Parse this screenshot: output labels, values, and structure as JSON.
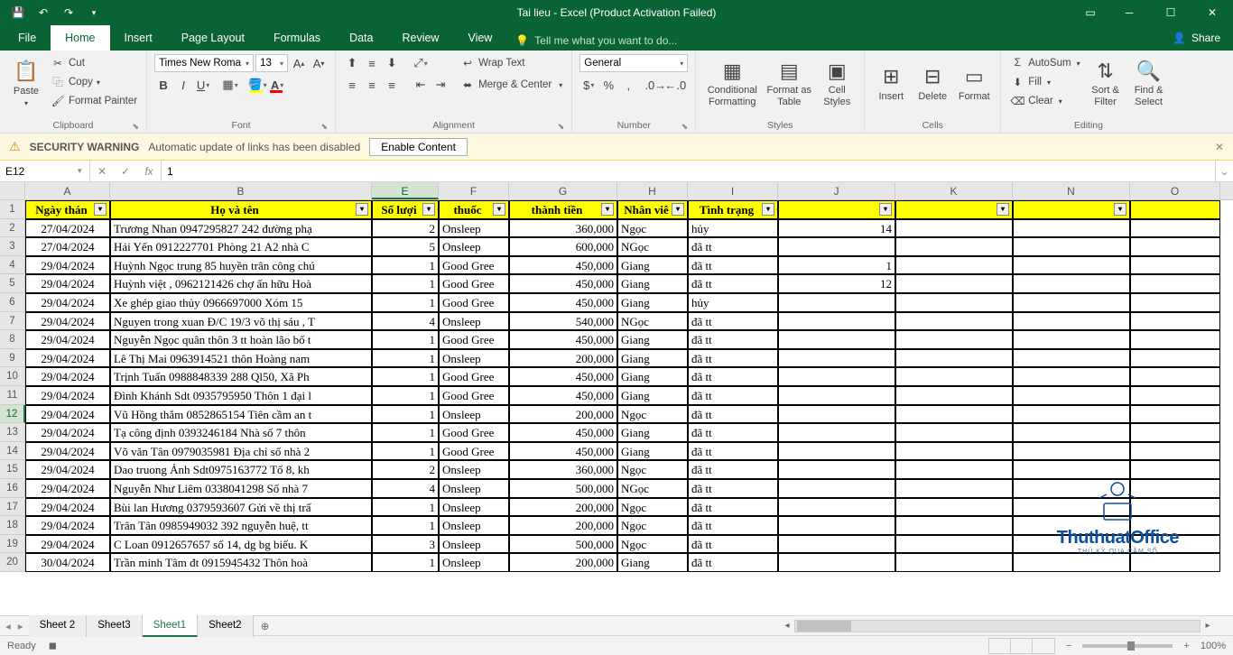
{
  "title": "Tai lieu - Excel (Product Activation Failed)",
  "tabs": [
    "File",
    "Home",
    "Insert",
    "Page Layout",
    "Formulas",
    "Data",
    "Review",
    "View"
  ],
  "active_tab": "Home",
  "tell_me": "Tell me what you want to do...",
  "share": "Share",
  "clipboard": {
    "paste": "Paste",
    "cut": "Cut",
    "copy": "Copy",
    "painter": "Format Painter",
    "label": "Clipboard"
  },
  "font": {
    "name": "Times New Roma",
    "size": "13",
    "label": "Font"
  },
  "alignment": {
    "wrap": "Wrap Text",
    "merge": "Merge & Center",
    "label": "Alignment"
  },
  "number": {
    "format": "General",
    "label": "Number"
  },
  "styles": {
    "cond": "Conditional Formatting",
    "tbl": "Format as Table",
    "cell": "Cell Styles",
    "label": "Styles"
  },
  "cells": {
    "insert": "Insert",
    "delete": "Delete",
    "format": "Format",
    "label": "Cells"
  },
  "editing": {
    "autosum": "AutoSum",
    "fill": "Fill",
    "clear": "Clear",
    "sort": "Sort & Filter",
    "find": "Find & Select",
    "label": "Editing"
  },
  "security": {
    "title": "SECURITY WARNING",
    "msg": "Automatic update of links has been disabled",
    "btn": "Enable Content"
  },
  "namebox": "E12",
  "formula": "1",
  "columns": [
    "A",
    "B",
    "E",
    "F",
    "G",
    "H",
    "I",
    "J",
    "K",
    "N",
    "O"
  ],
  "headers": {
    "A": "Ngày thán",
    "B": "Họ và tên",
    "E": "Số lượi",
    "F": "thuốc",
    "G": "thành tiền",
    "H": "Nhân viê",
    "I": "Tình trạng",
    "J": "",
    "K": "",
    "N": "",
    "O": ""
  },
  "rows": [
    {
      "n": 1
    },
    {
      "n": 2,
      "A": "27/04/2024",
      "B": "Trương Nhan 0947295827 242 đường phạ",
      "E": "2",
      "F": "Onsleep",
      "G": "360,000",
      "H": "Ngọc",
      "I": "hủy",
      "J": "14"
    },
    {
      "n": 3,
      "A": "27/04/2024",
      "B": "Hải Yến 0912227701 Phòng 21 A2 nhà C",
      "E": "5",
      "F": "Onsleep",
      "G": "600,000",
      "H": "NGọc",
      "I": "đã tt",
      "J": ""
    },
    {
      "n": 4,
      "A": "29/04/2024",
      "B": "Huỳnh Ngọc trung 85 huyền trân công chú",
      "E": "1",
      "F": "Good Gree",
      "G": "450,000",
      "H": "Giang",
      "I": "đã tt",
      "J": "1"
    },
    {
      "n": 5,
      "A": "29/04/2024",
      "B": "Huỳnh việt , 0962121426 chợ ấn hữu Hoà",
      "E": "1",
      "F": "Good Gree",
      "G": "450,000",
      "H": "Giang",
      "I": "đã tt",
      "J": "12"
    },
    {
      "n": 6,
      "A": "29/04/2024",
      "B": " Xe ghép giao thủy 0966697000 Xóm 15",
      "E": "1",
      "F": "Good Gree",
      "G": "450,000",
      "H": "Giang",
      "I": "hủy",
      "J": ""
    },
    {
      "n": 7,
      "A": "29/04/2024",
      "B": "Nguyen trong xuan Đ/C 19/3 võ thị sáu , T",
      "E": "4",
      "F": "Onsleep",
      "G": "540,000",
      "H": "NGọc",
      "I": "đã tt",
      "J": ""
    },
    {
      "n": 8,
      "A": "29/04/2024",
      "B": "Nguyễn Ngọc quân thôn 3 tt hoàn lão bố t",
      "E": "1",
      "F": "Good Gree",
      "G": "450,000",
      "H": "Giang",
      "I": "đã tt",
      "J": ""
    },
    {
      "n": 9,
      "A": "29/04/2024",
      "B": "Lê Thị Mai 0963914521 thôn Hoàng nam",
      "E": "1",
      "F": "Onsleep",
      "G": "200,000",
      "H": "Giang",
      "I": "đã tt",
      "J": ""
    },
    {
      "n": 10,
      "A": "29/04/2024",
      "B": "Trịnh Tuấn 0988848339 288 Ql50, Xã Ph",
      "E": "1",
      "F": "Good Gree",
      "G": "450,000",
      "H": "Giang",
      "I": "đã tt",
      "J": ""
    },
    {
      "n": 11,
      "A": "29/04/2024",
      "B": "Đình Khánh Sdt 0935795950 Thôn 1 đại l",
      "E": "1",
      "F": "Good Gree",
      "G": "450,000",
      "H": "Giang",
      "I": "đã tt",
      "J": ""
    },
    {
      "n": 12,
      "A": "29/04/2024",
      "B": "Vũ Hồng thắm 0852865154 Tiên cầm an t",
      "E": "1",
      "F": "Onsleep",
      "G": "200,000",
      "H": "Ngọc",
      "I": "đã tt",
      "J": ""
    },
    {
      "n": 13,
      "A": "29/04/2024",
      "B": "Tạ công định 0393246184 Nhà số 7 thôn",
      "E": "1",
      "F": "Good Gree",
      "G": "450,000",
      "H": "Giang",
      "I": "đã tt",
      "J": ""
    },
    {
      "n": 14,
      "A": "29/04/2024",
      "B": " Võ văn Tân 0979035981 Địa chỉ số nhà 2",
      "E": "1",
      "F": "Good Gree",
      "G": "450,000",
      "H": "Giang",
      "I": "đã tt",
      "J": ""
    },
    {
      "n": 15,
      "A": "29/04/2024",
      "B": "Dao truong Ảnh  Sdt0975163772 Tổ 8, kh",
      "E": "2",
      "F": "Onsleep",
      "G": "360,000",
      "H": "Ngọc",
      "I": "đã tt",
      "J": ""
    },
    {
      "n": 16,
      "A": "29/04/2024",
      "B": "Nguyễn Như Liêm 0338041298 Số nhà 7",
      "E": "4",
      "F": "Onsleep",
      "G": "500,000",
      "H": "NGọc",
      "I": "đã tt",
      "J": ""
    },
    {
      "n": 17,
      "A": "29/04/2024",
      "B": "Bùi lan Hương 0379593607 Gửi về thị trấ",
      "E": "1",
      "F": "Onsleep",
      "G": "200,000",
      "H": "Ngọc",
      "I": "đã tt",
      "J": ""
    },
    {
      "n": 18,
      "A": "29/04/2024",
      "B": "Trân Tân 0985949032 392  nguyễn huệ, tt",
      "E": "1",
      "F": "Onsleep",
      "G": "200,000",
      "H": "Ngọc",
      "I": "đã tt",
      "J": ""
    },
    {
      "n": 19,
      "A": "29/04/2024",
      "B": "C Loan 0912657657 số 14, dg bg biểu. K",
      "E": "3",
      "F": "Onsleep",
      "G": "500,000",
      "H": "Ngọc",
      "I": "đã tt",
      "J": ""
    },
    {
      "n": 20,
      "A": "30/04/2024",
      "B": "Trần minh Tâm đt 0915945432 Thôn hoà",
      "E": "1",
      "F": "Onsleep",
      "G": "200,000",
      "H": "Giang",
      "I": "đã tt",
      "J": ""
    }
  ],
  "sheets": [
    "Sheet 2",
    "Sheet3",
    "Sheet1",
    "Sheet2"
  ],
  "active_sheet": "Sheet1",
  "status": "Ready",
  "zoom": "100%",
  "watermark": {
    "t1": "ThuthuatOffice",
    "t2": "THỦ KỲ QUA CẦM SỐ"
  }
}
